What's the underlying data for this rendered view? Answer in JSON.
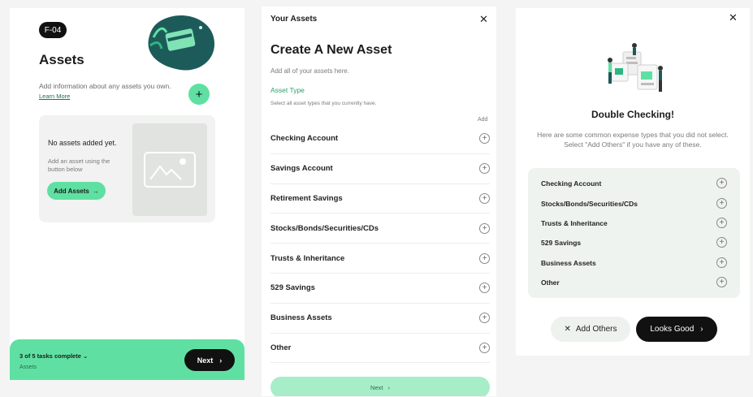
{
  "panel1": {
    "badge": "F-04",
    "title": "Assets",
    "description": "Add information about any assets you own.",
    "learn_more": "Learn More",
    "plus": "+",
    "empty_title": "No assets added yet.",
    "empty_sub": "Add an asset using the button below",
    "add_assets": "Add Assets",
    "arrow": "→",
    "tasks": "3 of 5 tasks complete",
    "chevron": "⌄",
    "tasks_sub": "Assets",
    "next": "Next",
    "next_chev": "›"
  },
  "panel2": {
    "header": "Your Assets",
    "close": "✕",
    "title": "Create A New Asset",
    "description": "Add all of your assets here.",
    "asset_type": "Asset Type",
    "asset_type_sub": "Select all asset types that you currently have.",
    "add_col": "Add",
    "items": [
      {
        "label": "Checking Account"
      },
      {
        "label": "Savings Account"
      },
      {
        "label": "Retirement Savings"
      },
      {
        "label": "Stocks/Bonds/Securities/CDs"
      },
      {
        "label": "Trusts & Inheritance"
      },
      {
        "label": "529 Savings"
      },
      {
        "label": "Business Assets"
      },
      {
        "label": "Other"
      }
    ],
    "plus": "+",
    "next": "Next",
    "next_chev": "›"
  },
  "panel3": {
    "close": "✕",
    "title": "Double Checking!",
    "description": "Here are some common expense types that you did not select. Select \"Add Others\" if you have any of these.",
    "items": [
      {
        "label": "Checking Account"
      },
      {
        "label": "Stocks/Bonds/Securities/CDs"
      },
      {
        "label": "Trusts & Inheritance"
      },
      {
        "label": "529 Savings"
      },
      {
        "label": "Business Assets"
      },
      {
        "label": "Other"
      }
    ],
    "plus": "+",
    "add_others_x": "✕",
    "add_others": "Add Others",
    "looks_good": "Looks Good",
    "looks_good_chev": "›"
  },
  "colors": {
    "accent": "#5fe0a2",
    "dark": "#111111",
    "illustration": "#1d5b5a"
  }
}
